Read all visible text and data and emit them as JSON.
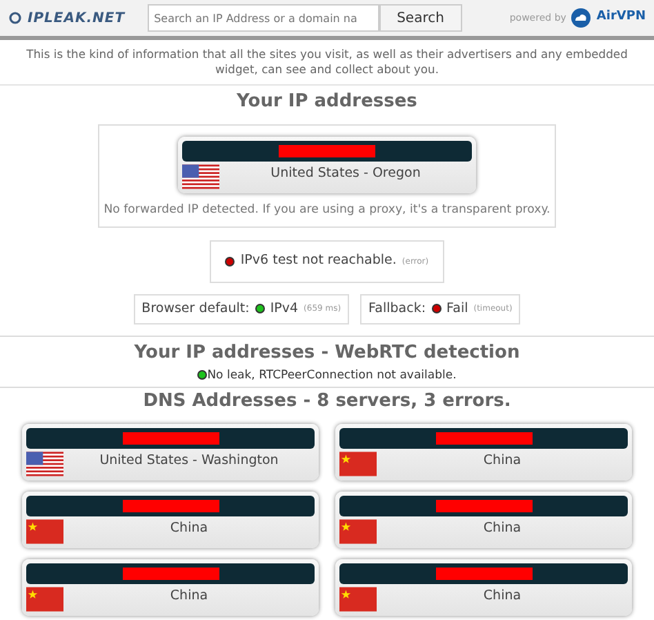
{
  "header": {
    "logo": "IPLEAK.NET",
    "search": {
      "placeholder": "Search an IP Address or a domain na"
    },
    "search_button": "Search",
    "powered_by": "powered by",
    "sponsor": "AirVPN"
  },
  "intro": "This is the kind of information that all the sites you visit, as well as their advertisers and any embedded widget, can see and collect about you.",
  "ip_section": {
    "title": "Your IP addresses",
    "address": {
      "kind": "us",
      "location": "United States - Oregon"
    },
    "note": "No forwarded IP detected. If you are using a proxy, it's a transparent proxy.",
    "ipv6": {
      "color": "#cc0000",
      "text": "IPv6 test not reachable.",
      "detail": "(error)"
    },
    "tests": [
      {
        "label": "Browser default:",
        "color": "#1ec21e",
        "value": "IPv4",
        "detail": "(659 ms)"
      },
      {
        "label": "Fallback:",
        "color": "#cc0000",
        "value": "Fail",
        "detail": "(timeout)"
      }
    ]
  },
  "webrtc": {
    "title": "Your IP addresses - WebRTC detection",
    "color": "#1ec21e",
    "text": "No leak, RTCPeerConnection not available."
  },
  "dns": {
    "title": "DNS Addresses - 8 servers, 3 errors.",
    "servers": [
      {
        "kind": "us",
        "location": "United States - Washington"
      },
      {
        "kind": "china",
        "location": "China"
      },
      {
        "kind": "china",
        "location": "China"
      },
      {
        "kind": "china",
        "location": "China"
      },
      {
        "kind": "china",
        "location": "China"
      },
      {
        "kind": "china",
        "location": "China"
      }
    ]
  }
}
